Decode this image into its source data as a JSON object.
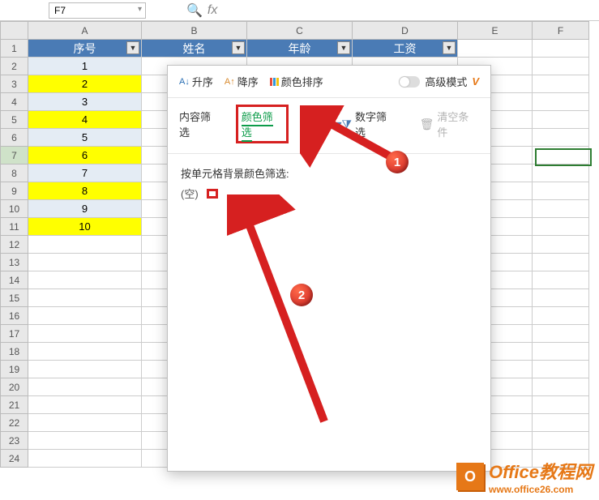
{
  "app": {
    "namebox": "F7",
    "fx": "fx"
  },
  "columns": [
    "A",
    "B",
    "C",
    "D",
    "E",
    "F"
  ],
  "rows": [
    "1",
    "2",
    "3",
    "4",
    "5",
    "6",
    "7",
    "8",
    "9",
    "10",
    "11",
    "12",
    "13",
    "14",
    "15",
    "16",
    "17",
    "18",
    "19",
    "20",
    "21",
    "22",
    "23",
    "24"
  ],
  "headers": {
    "A": "序号",
    "B": "姓名",
    "C": "年龄",
    "D": "工资"
  },
  "dataA": [
    "1",
    "2",
    "3",
    "4",
    "5",
    "6",
    "7",
    "8",
    "9",
    "10"
  ],
  "row_fills": [
    "lightblue",
    "yellow",
    "lightblue",
    "yellow",
    "lightblue",
    "yellow",
    "lightblue",
    "yellow",
    "lightblue",
    "yellow"
  ],
  "selected_rowhead": "7",
  "filter_panel": {
    "sort_asc": "升序",
    "sort_desc": "降序",
    "color_sort": "颜色排序",
    "advanced": "高级模式",
    "tab_content": "内容筛选",
    "tab_color": "颜色筛选",
    "num_filter": "数字筛选",
    "clear": "清空条件",
    "body_title": "按单元格背景颜色筛选:",
    "empty_label": "(空)",
    "swatch_color": "#ffff00"
  },
  "callouts": {
    "badge1": "1",
    "badge2": "2"
  },
  "watermark": {
    "title": "Office教程网",
    "url": "www.office26.com"
  }
}
